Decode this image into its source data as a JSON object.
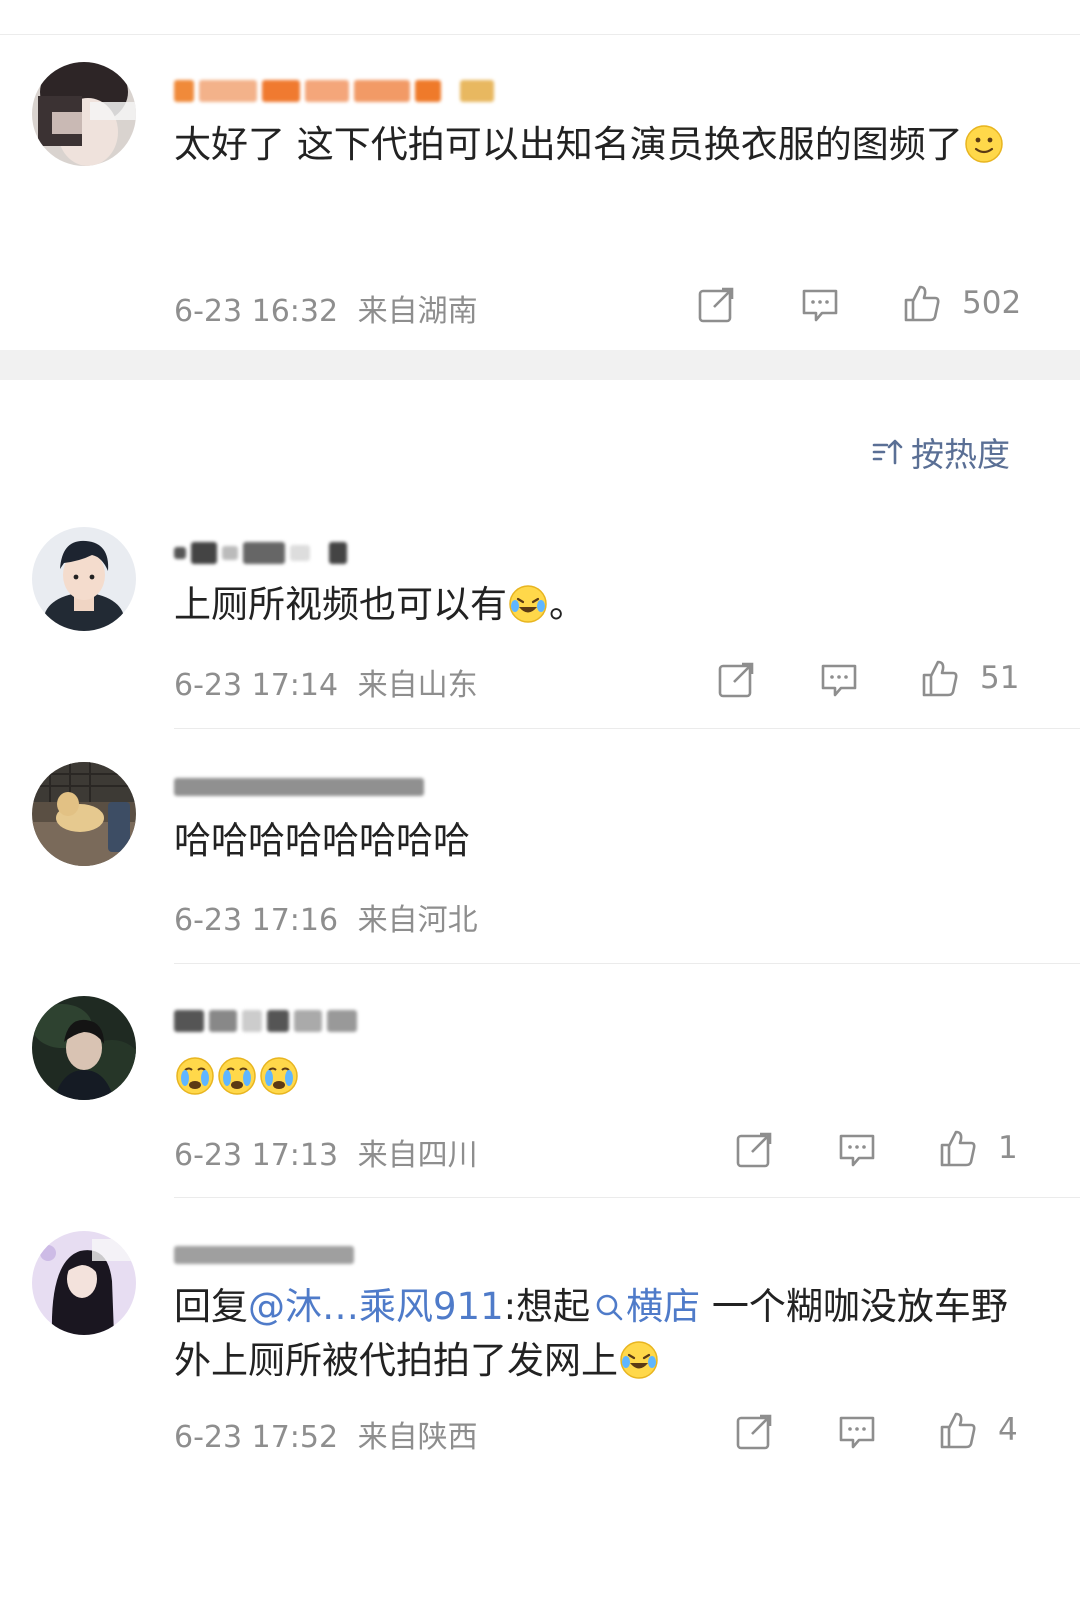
{
  "sort": {
    "label": "按热度"
  },
  "top_comment": {
    "text": "太好了 这下代拍可以出知名演员换衣服的图频了",
    "time": "6-23 16:32",
    "location": "来自湖南",
    "likes": "502"
  },
  "comments": [
    {
      "text": "上厕所视频也可以有",
      "text_tail": "。",
      "time": "6-23 17:14",
      "location": "来自山东",
      "likes": "51"
    },
    {
      "text": "哈哈哈哈哈哈哈哈",
      "time": "6-23 17:16",
      "location": "来自河北"
    },
    {
      "time": "6-23 17:13",
      "location": "来自四川",
      "likes": "1"
    },
    {
      "reply_prefix": "回复",
      "mention": "@沐…乘风911",
      "colon_text": ":想起",
      "topic": "横店",
      "text_after": " 一个糊咖没放车野外上厕所被代拍拍了发网上",
      "time": "6-23 17:52",
      "location": "来自陕西",
      "likes": "4"
    }
  ],
  "colors": {
    "link": "#4f7bc9",
    "meta": "#8e8e8e",
    "sort": "#5a6f95"
  }
}
